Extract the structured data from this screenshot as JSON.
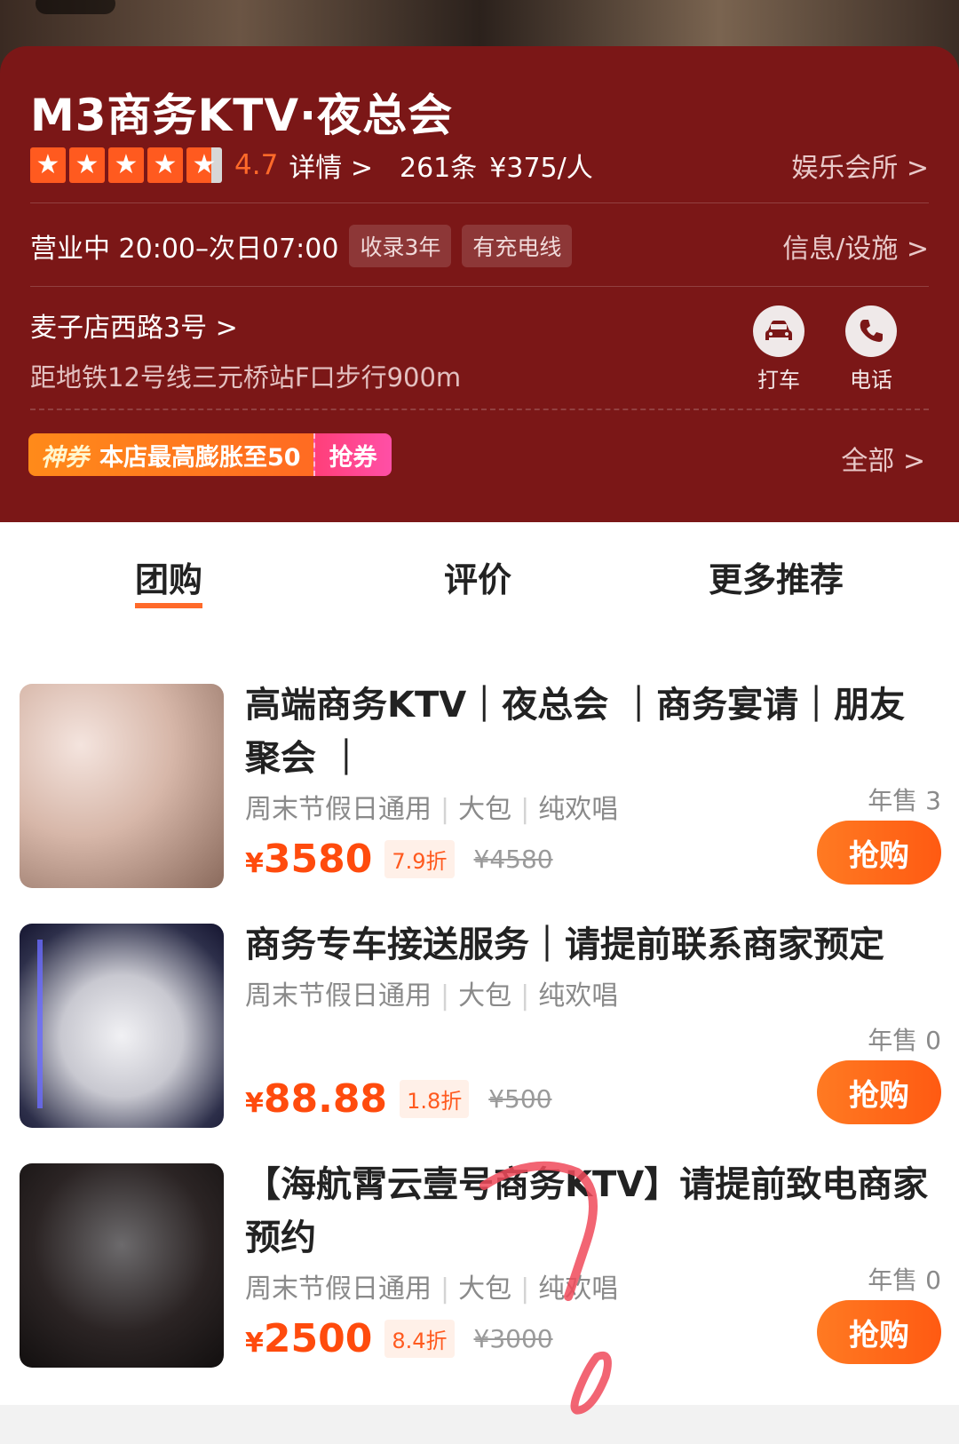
{
  "shop": {
    "title": "M3商务KTV·夜总会",
    "score": "4.7",
    "detail_label": "详情 >",
    "reviews": "261条",
    "price_per": "¥375/人",
    "category": "娱乐会所 >",
    "hours": "营业中 20:00–次日07:00",
    "tags": [
      "收录3年",
      "有充电线"
    ],
    "info_link": "信息/设施 >",
    "address": "麦子店西路3号 >",
    "distance": "距地铁12号线三元桥站F口步行900m",
    "actions": [
      {
        "label": "打车",
        "icon": "car-icon"
      },
      {
        "label": "电话",
        "icon": "phone-icon"
      }
    ]
  },
  "coupon": {
    "badge": "神券",
    "text": "本店最高膨胀至50",
    "action": "抢券",
    "all_link": "全部 >"
  },
  "tabs": [
    "团购",
    "评价",
    "更多推荐"
  ],
  "products": [
    {
      "title": "高端商务KTV｜夜总会 ｜商务宴请｜朋友聚会 ｜",
      "tags": [
        "周末节假日通用",
        "大包",
        "纯欢唱"
      ],
      "price": "3580",
      "discount": "7.9折",
      "original": "¥4580",
      "sold": "年售 3",
      "button": "抢购"
    },
    {
      "title": "商务专车接送服务｜请提前联系商家预定",
      "tags": [
        "周末节假日通用",
        "大包",
        "纯欢唱"
      ],
      "price": "88.88",
      "discount": "1.8折",
      "original": "¥500",
      "sold": "年售 0",
      "button": "抢购"
    },
    {
      "title": "【海航霄云壹号商务KTV】请提前致电商家预约",
      "tags": [
        "周末节假日通用",
        "大包",
        "纯欢唱"
      ],
      "price": "2500",
      "discount": "8.4折",
      "original": "¥3000",
      "sold": "年售 0",
      "button": "抢购"
    }
  ],
  "currency_symbol": "¥",
  "colors": {
    "header_bg": "#7b1717",
    "accent_orange": "#ff5a1f",
    "price_red": "#ff4b0d",
    "coupon_pink": "#ff3f7a",
    "annotation_red": "#f04a5a"
  }
}
